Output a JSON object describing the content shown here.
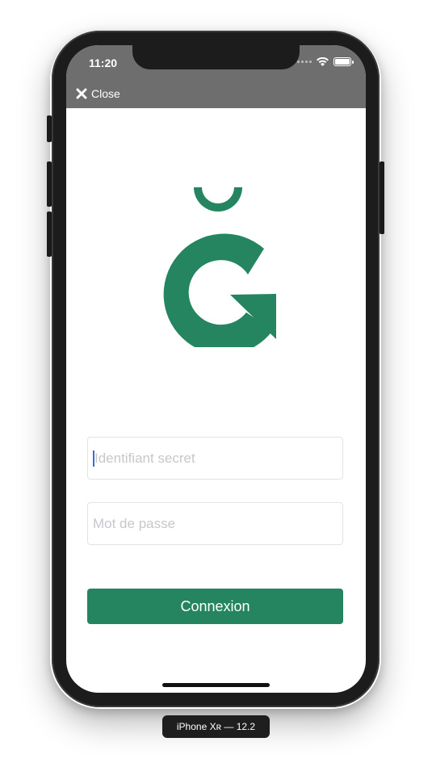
{
  "status_bar": {
    "time": "11:20"
  },
  "nav": {
    "close_label": "Close"
  },
  "login": {
    "username_placeholder": "Identifiant secret",
    "password_placeholder": "Mot de passe",
    "submit_label": "Connexion"
  },
  "brand": {
    "primary_color": "#258560",
    "logo": "g-breve-logo-icon"
  },
  "simulator": {
    "device_label": "iPhone Xʀ — 12.2"
  }
}
